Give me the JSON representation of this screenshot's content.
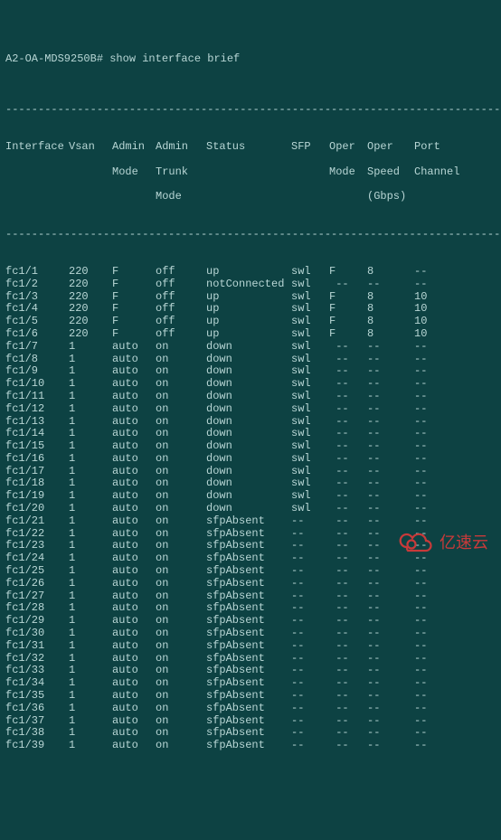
{
  "prompt": "A2-OA-MDS9250B# show interface brief",
  "divider": "-------------------------------------------------------------------------------",
  "headers": {
    "row1": {
      "iface": "Interface",
      "vsan": "Vsan",
      "admin": "Admin",
      "trunk": "Admin",
      "status": "Status",
      "sfp": "SFP",
      "oper": "Oper",
      "speed": "Oper",
      "port": "Port"
    },
    "row2": {
      "iface": "",
      "vsan": "",
      "admin": "Mode",
      "trunk": "Trunk",
      "status": "",
      "sfp": "",
      "oper": "Mode",
      "speed": "Speed",
      "port": "Channel"
    },
    "row3": {
      "iface": "",
      "vsan": "",
      "admin": "",
      "trunk": "Mode",
      "status": "",
      "sfp": "",
      "oper": "",
      "speed": "(Gbps)",
      "port": ""
    }
  },
  "rows": [
    {
      "iface": "fc1/1",
      "vsan": "220",
      "admin": "F",
      "trunk": "off",
      "status": "up",
      "sfp": "swl",
      "oper": "F",
      "speed": "8",
      "port": "--"
    },
    {
      "iface": "fc1/2",
      "vsan": "220",
      "admin": "F",
      "trunk": "off",
      "status": "notConnected",
      "sfp": "swl",
      "oper": " --",
      "speed": "--",
      "port": "--"
    },
    {
      "iface": "fc1/3",
      "vsan": "220",
      "admin": "F",
      "trunk": "off",
      "status": "up",
      "sfp": "swl",
      "oper": "F",
      "speed": "8",
      "port": "10"
    },
    {
      "iface": "fc1/4",
      "vsan": "220",
      "admin": "F",
      "trunk": "off",
      "status": "up",
      "sfp": "swl",
      "oper": "F",
      "speed": "8",
      "port": "10"
    },
    {
      "iface": "fc1/5",
      "vsan": "220",
      "admin": "F",
      "trunk": "off",
      "status": "up",
      "sfp": "swl",
      "oper": "F",
      "speed": "8",
      "port": "10"
    },
    {
      "iface": "fc1/6",
      "vsan": "220",
      "admin": "F",
      "trunk": "off",
      "status": "up",
      "sfp": "swl",
      "oper": "F",
      "speed": "8",
      "port": "10"
    },
    {
      "iface": "fc1/7",
      "vsan": "1",
      "admin": "auto",
      "trunk": "on",
      "status": "down",
      "sfp": "swl",
      "oper": " --",
      "speed": "--",
      "port": "--"
    },
    {
      "iface": "fc1/8",
      "vsan": "1",
      "admin": "auto",
      "trunk": "on",
      "status": "down",
      "sfp": "swl",
      "oper": " --",
      "speed": "--",
      "port": "--"
    },
    {
      "iface": "fc1/9",
      "vsan": "1",
      "admin": "auto",
      "trunk": "on",
      "status": "down",
      "sfp": "swl",
      "oper": " --",
      "speed": "--",
      "port": "--"
    },
    {
      "iface": "fc1/10",
      "vsan": "1",
      "admin": "auto",
      "trunk": "on",
      "status": "down",
      "sfp": "swl",
      "oper": " --",
      "speed": "--",
      "port": "--"
    },
    {
      "iface": "fc1/11",
      "vsan": "1",
      "admin": "auto",
      "trunk": "on",
      "status": "down",
      "sfp": "swl",
      "oper": " --",
      "speed": "--",
      "port": "--"
    },
    {
      "iface": "fc1/12",
      "vsan": "1",
      "admin": "auto",
      "trunk": "on",
      "status": "down",
      "sfp": "swl",
      "oper": " --",
      "speed": "--",
      "port": "--"
    },
    {
      "iface": "fc1/13",
      "vsan": "1",
      "admin": "auto",
      "trunk": "on",
      "status": "down",
      "sfp": "swl",
      "oper": " --",
      "speed": "--",
      "port": "--"
    },
    {
      "iface": "fc1/14",
      "vsan": "1",
      "admin": "auto",
      "trunk": "on",
      "status": "down",
      "sfp": "swl",
      "oper": " --",
      "speed": "--",
      "port": "--"
    },
    {
      "iface": "fc1/15",
      "vsan": "1",
      "admin": "auto",
      "trunk": "on",
      "status": "down",
      "sfp": "swl",
      "oper": " --",
      "speed": "--",
      "port": "--"
    },
    {
      "iface": "fc1/16",
      "vsan": "1",
      "admin": "auto",
      "trunk": "on",
      "status": "down",
      "sfp": "swl",
      "oper": " --",
      "speed": "--",
      "port": "--"
    },
    {
      "iface": "fc1/17",
      "vsan": "1",
      "admin": "auto",
      "trunk": "on",
      "status": "down",
      "sfp": "swl",
      "oper": " --",
      "speed": "--",
      "port": "--"
    },
    {
      "iface": "fc1/18",
      "vsan": "1",
      "admin": "auto",
      "trunk": "on",
      "status": "down",
      "sfp": "swl",
      "oper": " --",
      "speed": "--",
      "port": "--"
    },
    {
      "iface": "fc1/19",
      "vsan": "1",
      "admin": "auto",
      "trunk": "on",
      "status": "down",
      "sfp": "swl",
      "oper": " --",
      "speed": "--",
      "port": "--"
    },
    {
      "iface": "fc1/20",
      "vsan": "1",
      "admin": "auto",
      "trunk": "on",
      "status": "down",
      "sfp": "swl",
      "oper": " --",
      "speed": "--",
      "port": "--"
    },
    {
      "iface": "fc1/21",
      "vsan": "1",
      "admin": "auto",
      "trunk": "on",
      "status": "sfpAbsent",
      "sfp": "--",
      "oper": " --",
      "speed": "--",
      "port": "--"
    },
    {
      "iface": "fc1/22",
      "vsan": "1",
      "admin": "auto",
      "trunk": "on",
      "status": "sfpAbsent",
      "sfp": "--",
      "oper": " --",
      "speed": "--",
      "port": "--"
    },
    {
      "iface": "fc1/23",
      "vsan": "1",
      "admin": "auto",
      "trunk": "on",
      "status": "sfpAbsent",
      "sfp": "--",
      "oper": " --",
      "speed": "--",
      "port": "--"
    },
    {
      "iface": "fc1/24",
      "vsan": "1",
      "admin": "auto",
      "trunk": "on",
      "status": "sfpAbsent",
      "sfp": "--",
      "oper": " --",
      "speed": "--",
      "port": "--"
    },
    {
      "iface": "fc1/25",
      "vsan": "1",
      "admin": "auto",
      "trunk": "on",
      "status": "sfpAbsent",
      "sfp": "--",
      "oper": " --",
      "speed": "--",
      "port": "--"
    },
    {
      "iface": "fc1/26",
      "vsan": "1",
      "admin": "auto",
      "trunk": "on",
      "status": "sfpAbsent",
      "sfp": "--",
      "oper": " --",
      "speed": "--",
      "port": "--"
    },
    {
      "iface": "fc1/27",
      "vsan": "1",
      "admin": "auto",
      "trunk": "on",
      "status": "sfpAbsent",
      "sfp": "--",
      "oper": " --",
      "speed": "--",
      "port": "--"
    },
    {
      "iface": "fc1/28",
      "vsan": "1",
      "admin": "auto",
      "trunk": "on",
      "status": "sfpAbsent",
      "sfp": "--",
      "oper": " --",
      "speed": "--",
      "port": "--"
    },
    {
      "iface": "fc1/29",
      "vsan": "1",
      "admin": "auto",
      "trunk": "on",
      "status": "sfpAbsent",
      "sfp": "--",
      "oper": " --",
      "speed": "--",
      "port": "--"
    },
    {
      "iface": "fc1/30",
      "vsan": "1",
      "admin": "auto",
      "trunk": "on",
      "status": "sfpAbsent",
      "sfp": "--",
      "oper": " --",
      "speed": "--",
      "port": "--"
    },
    {
      "iface": "fc1/31",
      "vsan": "1",
      "admin": "auto",
      "trunk": "on",
      "status": "sfpAbsent",
      "sfp": "--",
      "oper": " --",
      "speed": "--",
      "port": "--"
    },
    {
      "iface": "fc1/32",
      "vsan": "1",
      "admin": "auto",
      "trunk": "on",
      "status": "sfpAbsent",
      "sfp": "--",
      "oper": " --",
      "speed": "--",
      "port": "--"
    },
    {
      "iface": "fc1/33",
      "vsan": "1",
      "admin": "auto",
      "trunk": "on",
      "status": "sfpAbsent",
      "sfp": "--",
      "oper": " --",
      "speed": "--",
      "port": "--"
    },
    {
      "iface": "fc1/34",
      "vsan": "1",
      "admin": "auto",
      "trunk": "on",
      "status": "sfpAbsent",
      "sfp": "--",
      "oper": " --",
      "speed": "--",
      "port": "--"
    },
    {
      "iface": "fc1/35",
      "vsan": "1",
      "admin": "auto",
      "trunk": "on",
      "status": "sfpAbsent",
      "sfp": "--",
      "oper": " --",
      "speed": "--",
      "port": "--"
    },
    {
      "iface": "fc1/36",
      "vsan": "1",
      "admin": "auto",
      "trunk": "on",
      "status": "sfpAbsent",
      "sfp": "--",
      "oper": " --",
      "speed": "--",
      "port": "--"
    },
    {
      "iface": "fc1/37",
      "vsan": "1",
      "admin": "auto",
      "trunk": "on",
      "status": "sfpAbsent",
      "sfp": "--",
      "oper": " --",
      "speed": "--",
      "port": "--"
    },
    {
      "iface": "fc1/38",
      "vsan": "1",
      "admin": "auto",
      "trunk": "on",
      "status": "sfpAbsent",
      "sfp": "--",
      "oper": " --",
      "speed": "--",
      "port": "--"
    },
    {
      "iface": "fc1/39",
      "vsan": "1",
      "admin": "auto",
      "trunk": "on",
      "status": "sfpAbsent",
      "sfp": "--",
      "oper": " --",
      "speed": "--",
      "port": "--"
    }
  ],
  "watermark": {
    "text": "亿速云"
  }
}
